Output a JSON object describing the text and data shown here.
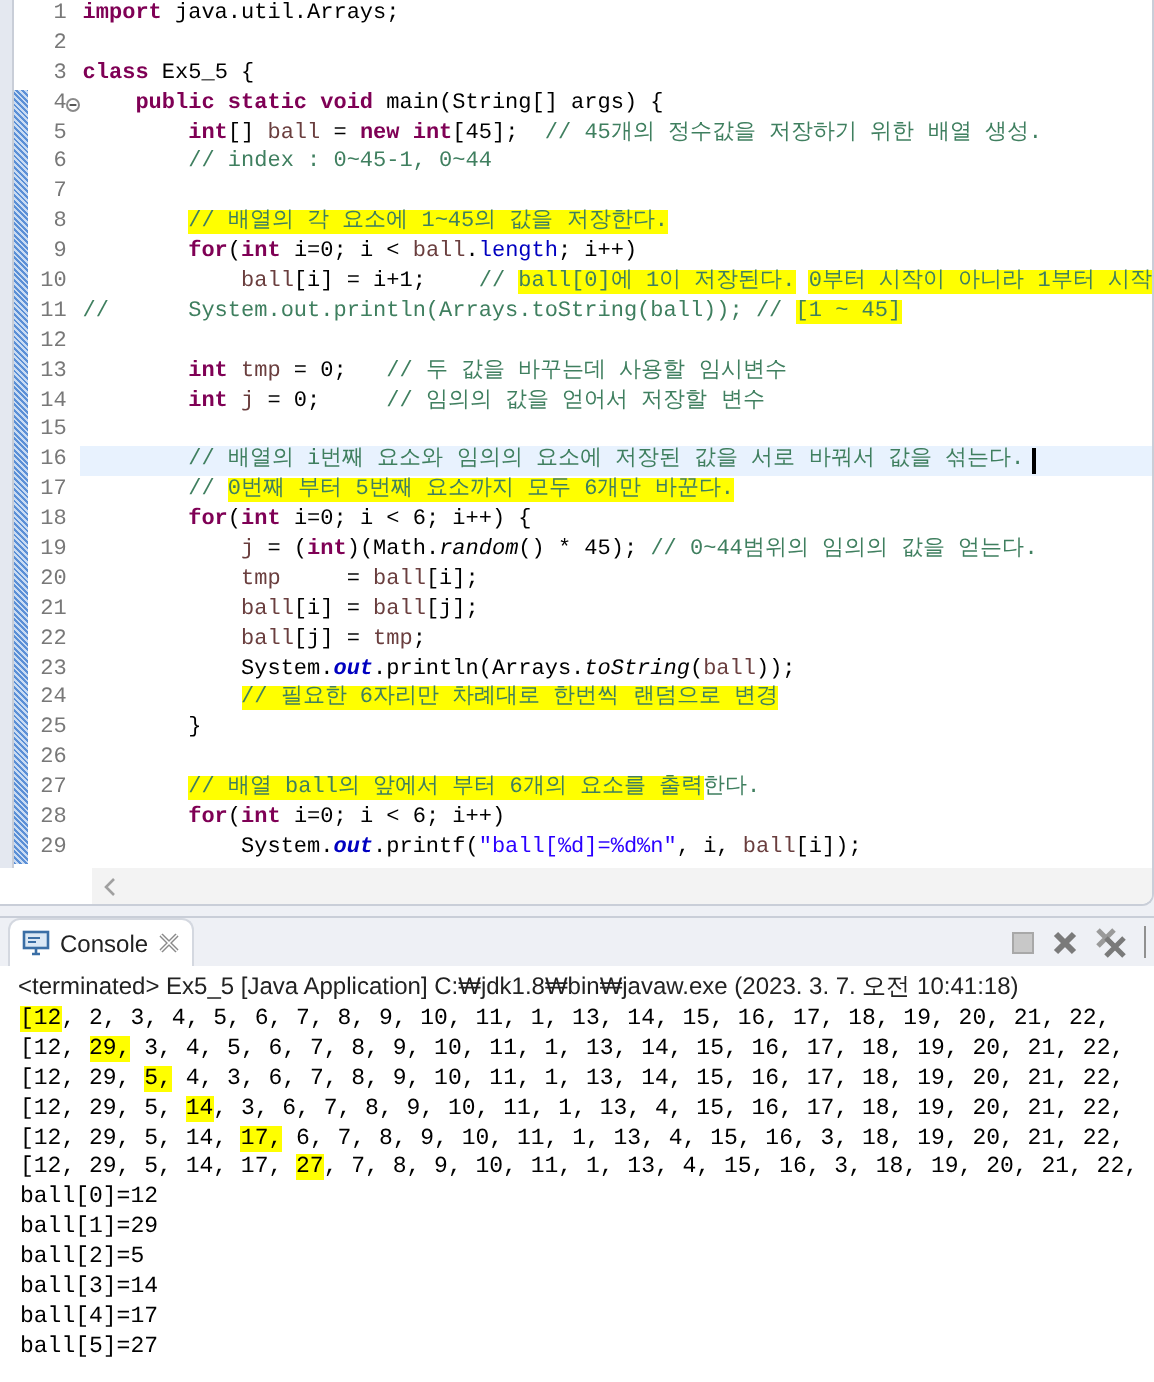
{
  "editor": {
    "lines": [
      {
        "number": "1",
        "fold_marker": false,
        "current": false,
        "segments": [
          {
            "text": "import",
            "kind": "keyword"
          },
          {
            "text": " java.util.Arrays;",
            "kind": "plain"
          }
        ]
      },
      {
        "number": "2",
        "fold_marker": false,
        "current": false
      },
      {
        "number": "3",
        "fold_marker": false,
        "current": false,
        "segments": [
          {
            "text": "class",
            "kind": "keyword"
          },
          {
            "text": " Ex5_5 {",
            "kind": "plain"
          }
        ]
      },
      {
        "number": "4",
        "fold_marker": true,
        "current": false,
        "segments": [
          {
            "text": "    public static void",
            "kind": "keyword"
          },
          {
            "text": " main(String[] args) {",
            "kind": "plain"
          }
        ]
      },
      {
        "number": "5",
        "fold_marker": false,
        "current": false,
        "segments": [
          {
            "text": "        int",
            "kind": "keyword"
          },
          {
            "text": "[] ",
            "kind": "plain"
          },
          {
            "text": "ball",
            "kind": "local"
          },
          {
            "text": " = ",
            "kind": "plain"
          },
          {
            "text": "new int",
            "kind": "keyword"
          },
          {
            "text": "[45];  ",
            "kind": "plain"
          },
          {
            "text": "// 45개의 정수값을 저장하기 위한 배열 생성.",
            "kind": "comment"
          }
        ]
      },
      {
        "number": "6",
        "fold_marker": false,
        "current": false,
        "segments": [
          {
            "text": "        // index : 0~45-1, 0~44",
            "kind": "comment"
          }
        ]
      },
      {
        "number": "7",
        "fold_marker": false,
        "current": false
      },
      {
        "number": "8",
        "fold_marker": false,
        "current": false,
        "segments": [
          {
            "text": "        // 배열의 각 요소에 1~45의 값을 저장한다.",
            "kind": "marked_comment"
          }
        ]
      },
      {
        "number": "9",
        "fold_marker": false,
        "current": false,
        "segments": [
          {
            "text": "        for",
            "kind": "keyword"
          },
          {
            "text": "(",
            "kind": "plain"
          },
          {
            "text": "int",
            "kind": "keyword"
          },
          {
            "text": " i=0; i < ",
            "kind": "plain"
          },
          {
            "text": "ball",
            "kind": "local"
          },
          {
            "text": ".",
            "kind": "plain"
          },
          {
            "text": "length",
            "kind": "field"
          },
          {
            "text": "; i++)",
            "kind": "plain"
          }
        ]
      },
      {
        "number": "10",
        "fold_marker": false,
        "current": false,
        "segments": [
          {
            "text": "            ball",
            "kind": "local"
          },
          {
            "text": "[i] = i+1;    ",
            "kind": "plain"
          },
          {
            "text": "// ",
            "kind": "comment"
          },
          {
            "text": "ball[0]에 1이 저장된다.",
            "kind": "marked_comment"
          },
          {
            "text": " 0부터 시작이 아니라 1부터 시작",
            "kind": "marked_comment"
          }
        ]
      },
      {
        "number": "11",
        "fold_marker": false,
        "current": false,
        "segments": [
          {
            "text": "//      System.out.println(Arrays.toString(ball)); // ",
            "kind": "comment"
          },
          {
            "text": "[1 ~ 45]",
            "kind": "marked_comment"
          }
        ]
      },
      {
        "number": "12",
        "fold_marker": false,
        "current": false
      },
      {
        "number": "13",
        "fold_marker": false,
        "current": false,
        "segments": [
          {
            "text": "        int",
            "kind": "keyword"
          },
          {
            "text": " tmp",
            "kind": "local"
          },
          {
            "text": " = 0;   ",
            "kind": "plain"
          },
          {
            "text": "// 두 값을 바꾸는데 사용할 임시변수",
            "kind": "comment"
          }
        ]
      },
      {
        "number": "14",
        "fold_marker": false,
        "current": false,
        "segments": [
          {
            "text": "        int",
            "kind": "keyword"
          },
          {
            "text": " j",
            "kind": "local"
          },
          {
            "text": " = 0;     ",
            "kind": "plain"
          },
          {
            "text": "// 임의의 값을 얻어서 저장할 변수",
            "kind": "comment"
          }
        ]
      },
      {
        "number": "15",
        "fold_marker": false,
        "current": false
      },
      {
        "number": "16",
        "fold_marker": false,
        "current": true,
        "segments": [
          {
            "text": "        // 배열의 i번째 요소와 임의의 요소에 저장된 값을 서로 바꿔서 값을 섞는다.",
            "kind": "comment"
          }
        ]
      },
      {
        "number": "17",
        "fold_marker": false,
        "current": false,
        "segments": [
          {
            "text": "        // ",
            "kind": "comment"
          },
          {
            "text": "0번째 부터 5번째 요소까지 모두 6개만 바꾼다.",
            "kind": "marked_comment"
          }
        ]
      },
      {
        "number": "18",
        "fold_marker": false,
        "current": false,
        "segments": [
          {
            "text": "        for",
            "kind": "keyword"
          },
          {
            "text": "(",
            "kind": "plain"
          },
          {
            "text": "int",
            "kind": "keyword"
          },
          {
            "text": " i=0; i < 6; i++) {",
            "kind": "plain"
          }
        ]
      },
      {
        "number": "19",
        "fold_marker": false,
        "current": false,
        "segments": [
          {
            "text": "            j",
            "kind": "local"
          },
          {
            "text": " = (",
            "kind": "plain"
          },
          {
            "text": "int",
            "kind": "keyword"
          },
          {
            "text": ")(Math.",
            "kind": "plain"
          },
          {
            "text": "random",
            "kind": "static_method"
          },
          {
            "text": "() * 45); ",
            "kind": "plain"
          },
          {
            "text": "// 0~44범위의 임의의 값을 얻는다.",
            "kind": "comment"
          }
        ]
      },
      {
        "number": "20",
        "fold_marker": false,
        "current": false,
        "segments": [
          {
            "text": "            tmp",
            "kind": "local"
          },
          {
            "text": "     = ",
            "kind": "plain"
          },
          {
            "text": "ball",
            "kind": "local"
          },
          {
            "text": "[i];",
            "kind": "plain"
          }
        ]
      },
      {
        "number": "21",
        "fold_marker": false,
        "current": false,
        "segments": [
          {
            "text": "            ball",
            "kind": "local"
          },
          {
            "text": "[i] = ",
            "kind": "plain"
          },
          {
            "text": "ball",
            "kind": "local"
          },
          {
            "text": "[j];",
            "kind": "plain"
          }
        ]
      },
      {
        "number": "22",
        "fold_marker": false,
        "current": false,
        "segments": [
          {
            "text": "            ball",
            "kind": "local"
          },
          {
            "text": "[j] = ",
            "kind": "plain"
          },
          {
            "text": "tmp",
            "kind": "local"
          },
          {
            "text": ";",
            "kind": "plain"
          }
        ]
      },
      {
        "number": "23",
        "fold_marker": false,
        "current": false,
        "segments": [
          {
            "text": "            System.",
            "kind": "plain"
          },
          {
            "text": "out",
            "kind": "static_field"
          },
          {
            "text": ".println(Arrays.",
            "kind": "plain"
          },
          {
            "text": "toString",
            "kind": "static_method"
          },
          {
            "text": "(",
            "kind": "plain"
          },
          {
            "text": "ball",
            "kind": "local"
          },
          {
            "text": "));",
            "kind": "plain"
          }
        ]
      },
      {
        "number": "24",
        "fold_marker": false,
        "current": false,
        "segments": [
          {
            "text": "            // 필요한 6자리만 차례대로 한번씩 랜덤으로 변경",
            "kind": "marked_comment"
          }
        ]
      },
      {
        "number": "25",
        "fold_marker": false,
        "current": false,
        "segments": [
          {
            "text": "        }",
            "kind": "plain"
          }
        ]
      },
      {
        "number": "26",
        "fold_marker": false,
        "current": false
      },
      {
        "number": "27",
        "fold_marker": false,
        "current": false,
        "segments": [
          {
            "text": "        // 배열 ball의 앞에서 부터 6개의 요소를 출력",
            "kind": "marked_comment"
          },
          {
            "text": "한다.",
            "kind": "comment"
          }
        ]
      },
      {
        "number": "28",
        "fold_marker": false,
        "current": false,
        "segments": [
          {
            "text": "        for",
            "kind": "keyword"
          },
          {
            "text": "(",
            "kind": "plain"
          },
          {
            "text": "int",
            "kind": "keyword"
          },
          {
            "text": " i=0; i < 6; i++)",
            "kind": "plain"
          }
        ]
      },
      {
        "number": "29",
        "fold_marker": false,
        "current": false,
        "segments": [
          {
            "text": "            System.",
            "kind": "plain"
          },
          {
            "text": "out",
            "kind": "static_field"
          },
          {
            "text": ".printf(",
            "kind": "plain"
          },
          {
            "text": "\"ball[%d]=%d%n\"",
            "kind": "string"
          },
          {
            "text": ", i, ",
            "kind": "plain"
          },
          {
            "text": "ball",
            "kind": "local"
          },
          {
            "text": "[i]);",
            "kind": "plain"
          }
        ]
      }
    ]
  },
  "console": {
    "tab": {
      "label": "Console"
    },
    "status": "<terminated> Ex5_5 [Java Application] C:₩jdk1.8₩bin₩javaw.exe (2023. 3. 7. 오전 10:41:18)",
    "output": [
      {
        "segments": [
          {
            "text": "[12",
            "kind": "marked"
          },
          {
            "text": ", 2, 3, 4, 5, 6, 7, 8, 9, 10, 11, 1, 13, 14, 15, 16, 17, 18, 19, 20, 21, 22,",
            "kind": "plain"
          }
        ]
      },
      {
        "segments": [
          {
            "text": "[12, ",
            "kind": "plain"
          },
          {
            "text": "29,",
            "kind": "marked"
          },
          {
            "text": " 3, 4, 5, 6, 7, 8, 9, 10, 11, 1, 13, 14, 15, 16, 17, 18, 19, 20, 21, 22,",
            "kind": "plain"
          }
        ]
      },
      {
        "segments": [
          {
            "text": "[12, 29, ",
            "kind": "plain"
          },
          {
            "text": "5,",
            "kind": "marked"
          },
          {
            "text": " 4, 3, 6, 7, 8, 9, 10, 11, 1, 13, 14, 15, 16, 17, 18, 19, 20, 21, 22,",
            "kind": "plain"
          }
        ]
      },
      {
        "segments": [
          {
            "text": "[12, 29, 5, ",
            "kind": "plain"
          },
          {
            "text": "14",
            "kind": "marked"
          },
          {
            "text": ", 3, 6, 7, 8, 9, 10, 11, 1, 13, 4, 15, 16, 17, 18, 19, 20, 21, 22,",
            "kind": "plain"
          }
        ]
      },
      {
        "segments": [
          {
            "text": "[12, 29, 5, 14, ",
            "kind": "plain"
          },
          {
            "text": "17,",
            "kind": "marked"
          },
          {
            "text": " 6, 7, 8, 9, 10, 11, 1, 13, 4, 15, 16, 3, 18, 19, 20, 21, 22,",
            "kind": "plain"
          }
        ]
      },
      {
        "segments": [
          {
            "text": "[12, 29, 5, 14, 17, ",
            "kind": "plain"
          },
          {
            "text": "27",
            "kind": "marked"
          },
          {
            "text": ", 7, 8, 9, 10, 11, 1, 13, 4, 15, 16, 3, 18, 19, 20, 21, 22,",
            "kind": "plain"
          }
        ]
      },
      {
        "segments": [
          {
            "text": "ball[0]=12",
            "kind": "plain"
          }
        ]
      },
      {
        "segments": [
          {
            "text": "ball[1]=29",
            "kind": "plain"
          }
        ]
      },
      {
        "segments": [
          {
            "text": "ball[2]=5",
            "kind": "plain"
          }
        ]
      },
      {
        "segments": [
          {
            "text": "ball[3]=14",
            "kind": "plain"
          }
        ]
      },
      {
        "segments": [
          {
            "text": "ball[4]=17",
            "kind": "plain"
          }
        ]
      },
      {
        "segments": [
          {
            "text": "ball[5]=27",
            "kind": "plain"
          }
        ]
      }
    ]
  }
}
